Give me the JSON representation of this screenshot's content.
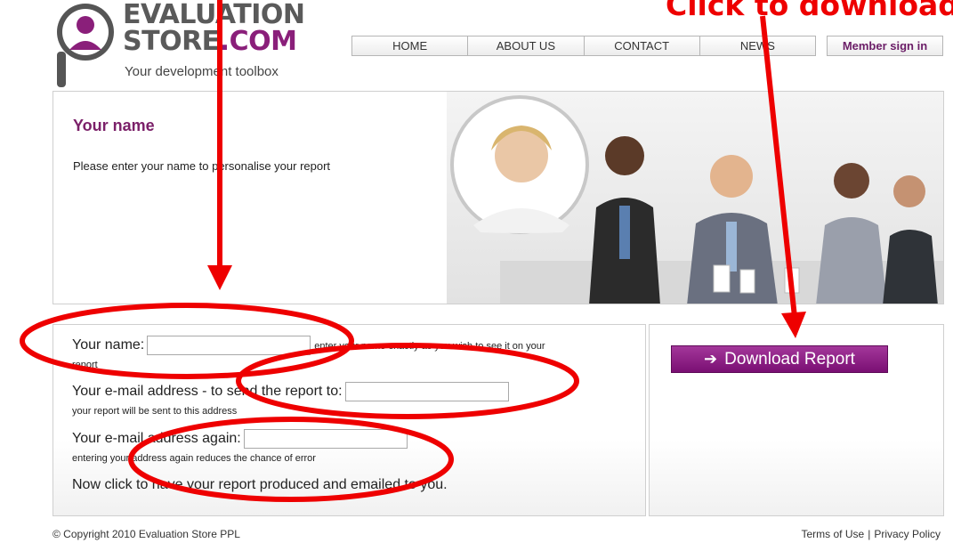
{
  "header": {
    "logo_line1": "EVALUATION",
    "logo_line2_prefix": "STORE",
    "logo_line2_suffix": ".COM",
    "tagline": "Your development toolbox"
  },
  "nav": {
    "items": [
      "HOME",
      "ABOUT US",
      "CONTACT",
      "NEWS"
    ],
    "member_signin": "Member sign in"
  },
  "hero": {
    "title": "Your name",
    "text": "Please enter your name to personalise your report"
  },
  "form": {
    "name_label": "Your name:",
    "name_value": "",
    "name_hint": "enter your name exactly as you wish to see it on your",
    "name_hint_cont": "report",
    "email_label": "Your e-mail address - to send the report to:",
    "email_value": "",
    "email_hint": "your report will be sent to this address",
    "email2_label": "Your e-mail address again:",
    "email2_value": "",
    "email2_hint": "entering your address again reduces the chance of error",
    "instruction": "Now click to have your report produced and emailed to you."
  },
  "download": {
    "label": "Download Report"
  },
  "footer": {
    "copyright": "© Copyright 2010 Evaluation Store PPL",
    "terms": "Terms of Use",
    "separator": "|",
    "privacy": "Privacy Policy"
  },
  "annotation": {
    "text": "Click to download"
  },
  "colors": {
    "brand_purple": "#7b2069",
    "button_purple": "#8e1f86",
    "annotation_red": "#ee0000"
  }
}
